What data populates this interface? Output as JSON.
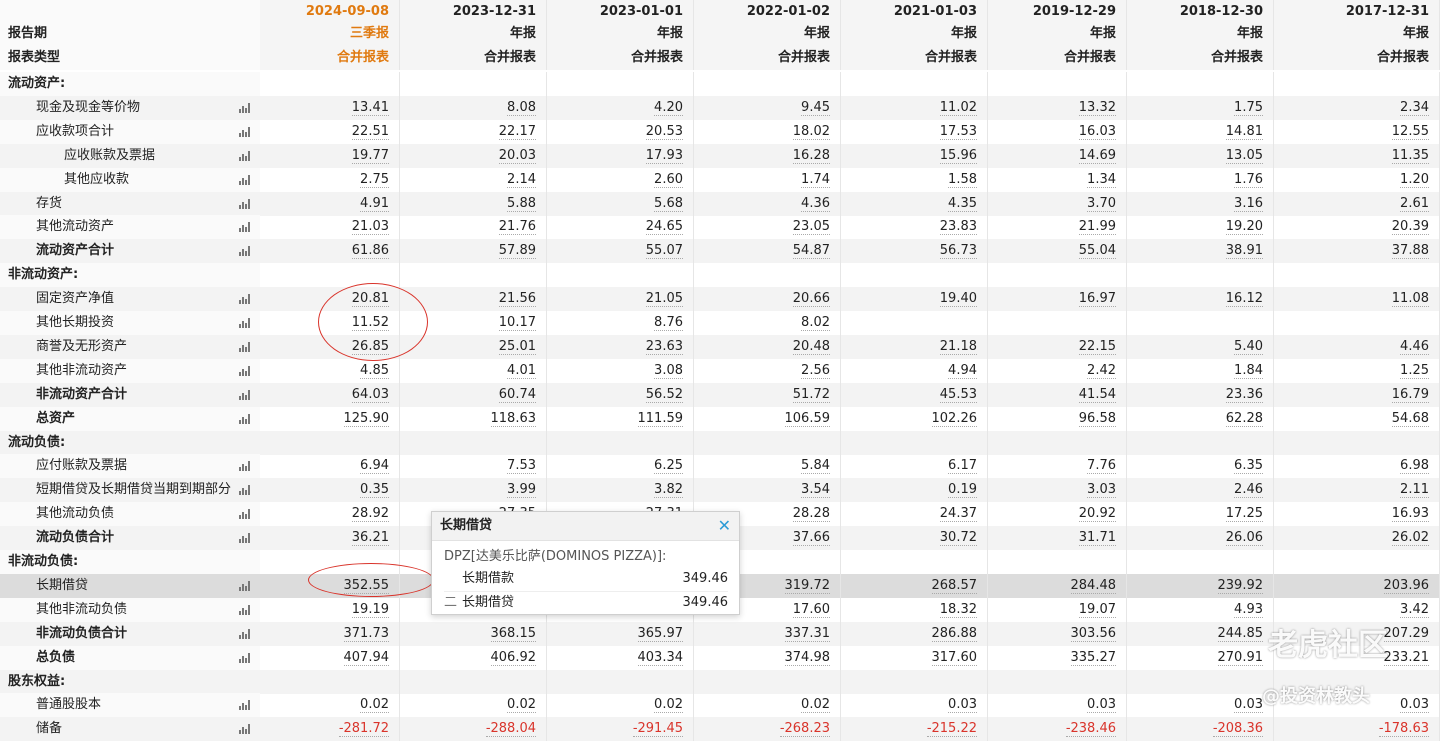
{
  "header": {
    "period_label": "报告期",
    "type_label": "报表类型",
    "dates": [
      "2024-09-08",
      "2023-12-31",
      "2023-01-01",
      "2022-01-02",
      "2021-01-03",
      "2019-12-29",
      "2018-12-30",
      "2017-12-31"
    ],
    "periods": [
      "三季报",
      "年报",
      "年报",
      "年报",
      "年报",
      "年报",
      "年报",
      "年报"
    ],
    "types": [
      "合并报表",
      "合并报表",
      "合并报表",
      "合并报表",
      "合并报表",
      "合并报表",
      "合并报表",
      "合并报表"
    ]
  },
  "rows": [
    {
      "label": "流动资产:",
      "level": 0,
      "bold": true,
      "section": true,
      "values": []
    },
    {
      "label": "现金及现金等价物",
      "level": 1,
      "values": [
        "13.41",
        "8.08",
        "4.20",
        "9.45",
        "11.02",
        "13.32",
        "1.75",
        "2.34"
      ]
    },
    {
      "label": "应收款项合计",
      "level": 1,
      "values": [
        "22.51",
        "22.17",
        "20.53",
        "18.02",
        "17.53",
        "16.03",
        "14.81",
        "12.55"
      ]
    },
    {
      "label": "应收账款及票据",
      "level": 2,
      "values": [
        "19.77",
        "20.03",
        "17.93",
        "16.28",
        "15.96",
        "14.69",
        "13.05",
        "11.35"
      ]
    },
    {
      "label": "其他应收款",
      "level": 2,
      "values": [
        "2.75",
        "2.14",
        "2.60",
        "1.74",
        "1.58",
        "1.34",
        "1.76",
        "1.20"
      ]
    },
    {
      "label": "存货",
      "level": 1,
      "values": [
        "4.91",
        "5.88",
        "5.68",
        "4.36",
        "4.35",
        "3.70",
        "3.16",
        "2.61"
      ]
    },
    {
      "label": "其他流动资产",
      "level": 1,
      "values": [
        "21.03",
        "21.76",
        "24.65",
        "23.05",
        "23.83",
        "21.99",
        "19.20",
        "20.39"
      ]
    },
    {
      "label": "流动资产合计",
      "level": 1,
      "bold": true,
      "values": [
        "61.86",
        "57.89",
        "55.07",
        "54.87",
        "56.73",
        "55.04",
        "38.91",
        "37.88"
      ]
    },
    {
      "label": "非流动资产:",
      "level": 0,
      "bold": true,
      "section": true,
      "values": []
    },
    {
      "label": "固定资产净值",
      "level": 1,
      "values": [
        "20.81",
        "21.56",
        "21.05",
        "20.66",
        "19.40",
        "16.97",
        "16.12",
        "11.08"
      ]
    },
    {
      "label": "其他长期投资",
      "level": 1,
      "values": [
        "11.52",
        "10.17",
        "8.76",
        "8.02",
        "",
        "",
        "",
        ""
      ]
    },
    {
      "label": "商誉及无形资产",
      "level": 1,
      "values": [
        "26.85",
        "25.01",
        "23.63",
        "20.48",
        "21.18",
        "22.15",
        "5.40",
        "4.46"
      ]
    },
    {
      "label": "其他非流动资产",
      "level": 1,
      "values": [
        "4.85",
        "4.01",
        "3.08",
        "2.56",
        "4.94",
        "2.42",
        "1.84",
        "1.25"
      ]
    },
    {
      "label": "非流动资产合计",
      "level": 1,
      "bold": true,
      "values": [
        "64.03",
        "60.74",
        "56.52",
        "51.72",
        "45.53",
        "41.54",
        "23.36",
        "16.79"
      ]
    },
    {
      "label": "总资产",
      "level": 1,
      "bold": true,
      "values": [
        "125.90",
        "118.63",
        "111.59",
        "106.59",
        "102.26",
        "96.58",
        "62.28",
        "54.68"
      ]
    },
    {
      "label": "流动负债:",
      "level": 0,
      "bold": true,
      "section": true,
      "values": []
    },
    {
      "label": "应付账款及票据",
      "level": 1,
      "values": [
        "6.94",
        "7.53",
        "6.25",
        "5.84",
        "6.17",
        "7.76",
        "6.35",
        "6.98"
      ]
    },
    {
      "label": "短期借贷及长期借贷当期到期部分",
      "level": 1,
      "values": [
        "0.35",
        "3.99",
        "3.82",
        "3.54",
        "0.19",
        "3.03",
        "2.46",
        "2.11"
      ]
    },
    {
      "label": "其他流动负债",
      "level": 1,
      "values": [
        "28.92",
        "27.35",
        "27.31",
        "28.28",
        "24.37",
        "20.92",
        "17.25",
        "16.93"
      ]
    },
    {
      "label": "流动负债合计",
      "level": 1,
      "bold": true,
      "values": [
        "36.21",
        "",
        "",
        "37.66",
        "30.72",
        "31.71",
        "26.06",
        "26.02"
      ]
    },
    {
      "label": "非流动负债:",
      "level": 0,
      "bold": true,
      "section": true,
      "values": []
    },
    {
      "label": "长期借贷",
      "level": 1,
      "highlight": true,
      "values": [
        "352.55",
        "",
        "",
        "319.72",
        "268.57",
        "284.48",
        "239.92",
        "203.96"
      ]
    },
    {
      "label": "其他非流动负债",
      "level": 1,
      "values": [
        "19.19",
        "",
        "",
        "17.60",
        "18.32",
        "19.07",
        "4.93",
        "3.42"
      ]
    },
    {
      "label": "非流动负债合计",
      "level": 1,
      "bold": true,
      "values": [
        "371.73",
        "368.15",
        "365.97",
        "337.31",
        "286.88",
        "303.56",
        "244.85",
        "207.29"
      ]
    },
    {
      "label": "总负债",
      "level": 1,
      "bold": true,
      "values": [
        "407.94",
        "406.92",
        "403.34",
        "374.98",
        "317.60",
        "335.27",
        "270.91",
        "233.21"
      ]
    },
    {
      "label": "股东权益:",
      "level": 0,
      "bold": true,
      "section": true,
      "values": []
    },
    {
      "label": "普通股股本",
      "level": 1,
      "values": [
        "0.02",
        "0.02",
        "0.02",
        "0.02",
        "0.03",
        "0.03",
        "0.03",
        "0.03"
      ]
    },
    {
      "label": "储备",
      "level": 1,
      "negative": true,
      "values": [
        "-281.72",
        "-288.04",
        "-291.45",
        "-268.23",
        "-215.22",
        "-238.46",
        "-208.36",
        "-178.63"
      ]
    }
  ],
  "tooltip": {
    "title": "长期借贷",
    "close_icon": "✕",
    "company": "DPZ[达美乐比萨(DOMINOS PIZZA)]:",
    "lines": [
      {
        "symbol": "",
        "label": "长期借款",
        "value": "349.46"
      },
      {
        "symbol": "二",
        "label": "长期借贷",
        "value": "349.46"
      }
    ]
  },
  "watermarks": {
    "brand": "老虎社区",
    "author": "@投资林教头"
  },
  "colors": {
    "highlight_date": "#e07a10",
    "negative": "#d9342b",
    "annotation": "#d9342b",
    "close_icon": "#2b9bd6"
  }
}
